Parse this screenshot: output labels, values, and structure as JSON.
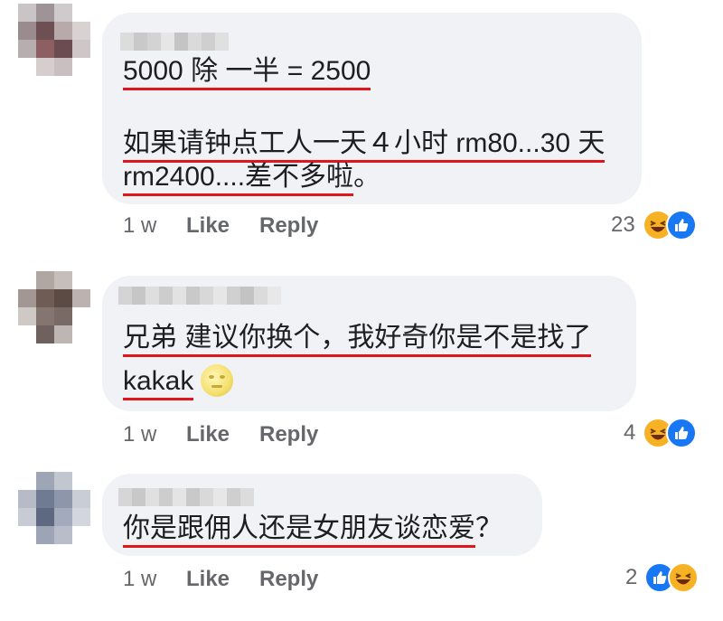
{
  "comments": [
    {
      "lines": [
        "5000 除 一半 = 2500",
        "如果请钟点工人一天４小时 rm80...30 天",
        "rm2400....差不多啦",
        "。"
      ],
      "time": "1 w",
      "like_label": "Like",
      "reply_label": "Reply",
      "reaction_count": "23",
      "reaction_icons": [
        "haha-icon",
        "like-icon"
      ]
    },
    {
      "lines": [
        "兄弟 建议你换个，我好奇你是不是找了",
        "kakak"
      ],
      "emoji": "full-moon-face-icon",
      "time": "1 w",
      "like_label": "Like",
      "reply_label": "Reply",
      "reaction_count": "4",
      "reaction_icons": [
        "haha-icon",
        "like-icon"
      ]
    },
    {
      "lines": [
        "你是跟佣人还是女朋友谈恋爱",
        "？"
      ],
      "time": "1 w",
      "like_label": "Like",
      "reply_label": "Reply",
      "reaction_count": "2",
      "reaction_icons": [
        "like-icon",
        "haha-icon"
      ]
    }
  ],
  "colors": {
    "bubble": "#f0f2f5",
    "underline": "#e0161c",
    "meta_text": "#65676b",
    "like_blue": "#1877f2",
    "haha_yellow": "#f7b125"
  }
}
